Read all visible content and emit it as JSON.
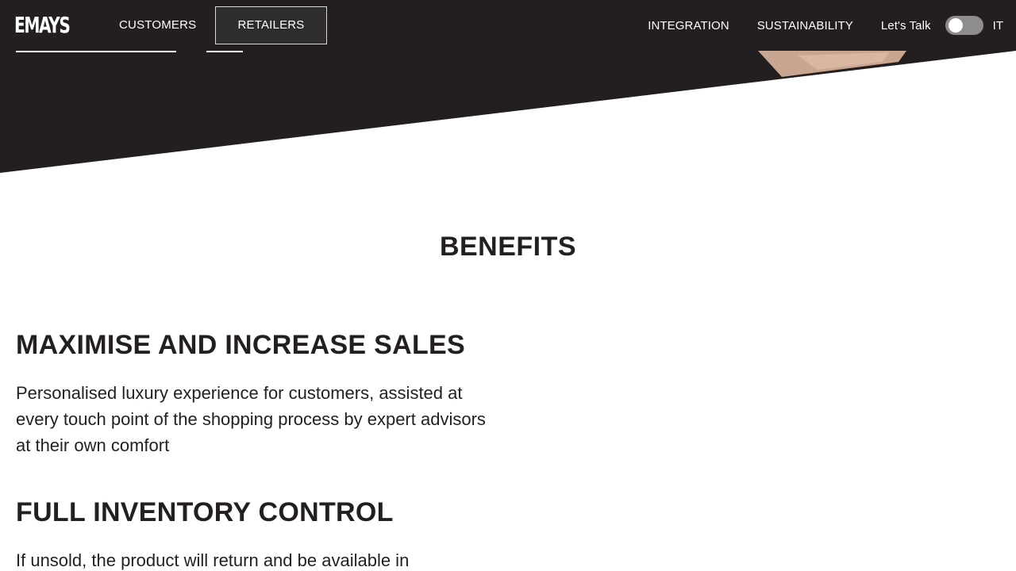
{
  "header": {
    "logo": "EMAYS",
    "nav_left": [
      {
        "label": "CUSTOMERS"
      },
      {
        "label": "RETAILERS"
      }
    ],
    "nav_right": [
      {
        "label": "INTEGRATION"
      },
      {
        "label": "SUSTAINABILITY"
      },
      {
        "label": "Let's Talk"
      }
    ],
    "language_toggle": {
      "label": "IT",
      "on": false
    }
  },
  "colors": {
    "dark": "#231f20",
    "accent_white": "#ffffff",
    "toggle_track": "#8e8c8d"
  },
  "main": {
    "section_title": "BENEFITS",
    "benefits": [
      {
        "title": "MAXIMISE AND INCREASE SALES",
        "text": "Personalised luxury experience for customers, assisted at every touch point of the shopping process by expert advisors at their own comfort"
      },
      {
        "title": "FULL INVENTORY CONTROL",
        "text": "If unsold, the product will return and be available in"
      }
    ]
  }
}
